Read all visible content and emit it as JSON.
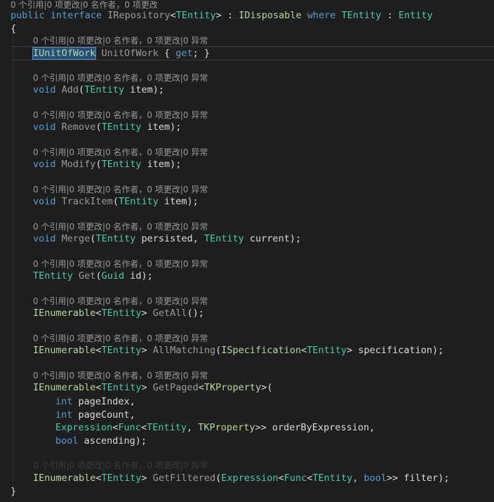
{
  "lens_top": "0 个引用|0 项更改|0 名作者，0 项更改",
  "lens": "0 个引用|0 项更改|0 名作者，0 项更改|0 异常",
  "decl": {
    "public": "public",
    "interface": "interface",
    "name": "IRepository",
    "lt": "<",
    "tparam": "TEntity",
    "gt": ">",
    "colon": " : ",
    "base": "IDisposable",
    "where": "where",
    "tparam2": "TEntity",
    "colon2": " : ",
    "constraint": "Entity"
  },
  "brace_open": "{",
  "brace_close": "}",
  "members": {
    "unitofwork": {
      "type": "IUnitOfWork",
      "name": "UnitOfWork",
      "open": " { ",
      "get": "get",
      "close": "; }"
    },
    "add": {
      "ret": "void",
      "name": "Add",
      "open": "(",
      "ptype": "TEntity",
      "rest": " item);"
    },
    "remove": {
      "ret": "void",
      "name": "Remove",
      "open": "(",
      "ptype": "TEntity",
      "rest": " item);"
    },
    "modify": {
      "ret": "void",
      "name": "Modify",
      "open": "(",
      "ptype": "TEntity",
      "rest": " item);"
    },
    "trackitem": {
      "ret": "void",
      "name": "TrackItem",
      "open": "(",
      "ptype": "TEntity",
      "rest": " item);"
    },
    "merge": {
      "ret": "void",
      "name": "Merge",
      "open": "(",
      "ptype": "TEntity",
      "mid": " persisted, ",
      "ptype2": "TEntity",
      "rest": " current);"
    },
    "get": {
      "ret": "TEntity",
      "name": "Get",
      "open": "(",
      "ptype": "Guid",
      "rest": " id);"
    },
    "getall": {
      "ret": "IEnumerable",
      "lt": "<",
      "targ": "TEntity",
      "gt": ">",
      "name": "GetAll",
      "rest": "();"
    },
    "allmatching": {
      "ret": "IEnumerable",
      "lt": "<",
      "targ": "TEntity",
      "gt": ">",
      "name": "AllMatching",
      "open": "(",
      "ptype": "ISpecification",
      "plt": "<",
      "parg": "TEntity",
      "rest": "> specification);"
    },
    "getpaged": {
      "ret": "IEnumerable",
      "lt": "<",
      "targ": "TEntity",
      "gt": ">",
      "name": "GetPaged",
      "glt": "<",
      "garg": "TKProperty",
      "gclose": ">(",
      "p1type": "int",
      "p1name": " pageIndex,",
      "p2type": "int",
      "p2name": " pageCount,",
      "p3type": "Expression",
      "p3lt": "<",
      "p3func": "Func",
      "p3lt2": "<",
      "p3a": "TEntity",
      "p3comma": ", ",
      "p3b": "TKProperty",
      "p3rest": ">> orderByExpression,",
      "p4type": "bool",
      "p4name": " ascending);"
    },
    "getfiltered": {
      "ret": "IEnumerable",
      "lt": "<",
      "targ": "TEntity",
      "gt": ">",
      "name": "GetFiltered",
      "open": "(",
      "ptype": "Expression",
      "plt": "<",
      "pfunc": "Func",
      "plt2": "<",
      "pa": "TEntity",
      "pcomma": ", ",
      "pb": "bool",
      "rest": ">> filter);"
    }
  }
}
